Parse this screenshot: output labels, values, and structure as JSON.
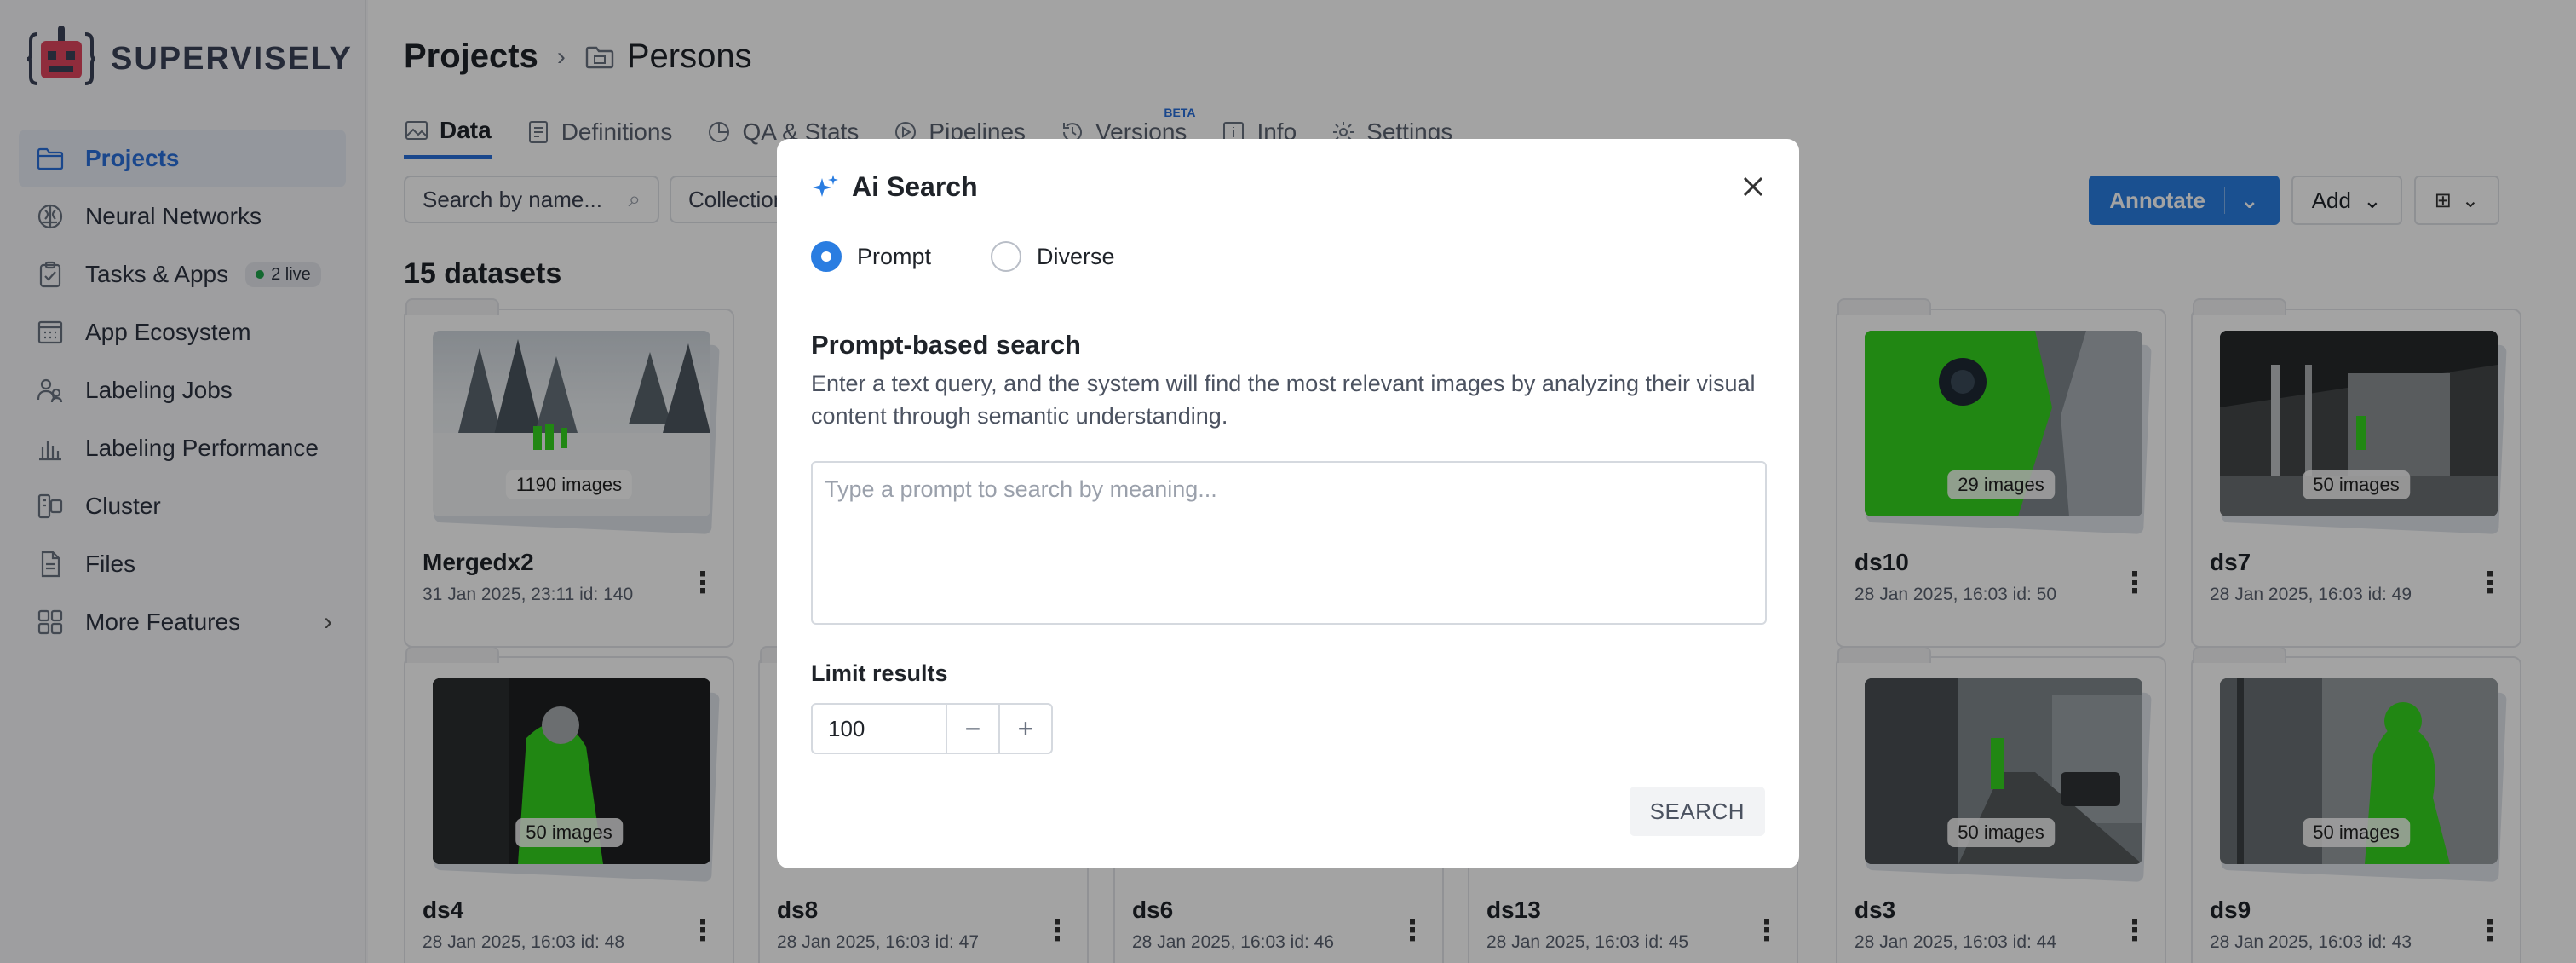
{
  "app": {
    "brand": "SUPERVISELY"
  },
  "sidebar": {
    "items": [
      {
        "label": "Projects",
        "icon": "folder-icon",
        "active": true
      },
      {
        "label": "Neural Networks",
        "icon": "brain-icon"
      },
      {
        "label": "Tasks & Apps",
        "icon": "clipboard-icon",
        "badge": "2 live"
      },
      {
        "label": "App Ecosystem",
        "icon": "grid-window-icon"
      },
      {
        "label": "Labeling Jobs",
        "icon": "people-icon"
      },
      {
        "label": "Labeling Performance",
        "icon": "bar-chart-icon"
      },
      {
        "label": "Cluster",
        "icon": "cluster-icon"
      },
      {
        "label": "Files",
        "icon": "file-icon"
      },
      {
        "label": "More Features",
        "icon": "apps-icon"
      }
    ]
  },
  "header": {
    "breadcrumb_root": "Projects",
    "breadcrumb_current": "Persons"
  },
  "tabs": [
    {
      "label": "Data",
      "active": true
    },
    {
      "label": "Definitions"
    },
    {
      "label": "QA & Stats"
    },
    {
      "label": "Pipelines"
    },
    {
      "label": "Versions",
      "badge": "BETA"
    },
    {
      "label": "Info"
    },
    {
      "label": "Settings"
    }
  ],
  "toolbar": {
    "search_placeholder": "Search by name...",
    "collection_label": "Collection",
    "annotate_label": "Annotate",
    "add_label": "Add"
  },
  "datasets_count_label": "15 datasets",
  "datasets": [
    {
      "name": "Mergedx2",
      "meta": "31 Jan 2025, 23:11  id: 140",
      "images": "1190 images",
      "theme": "snow"
    },
    {
      "name": "ds10",
      "meta": "28 Jan 2025, 16:03  id: 50",
      "images": "29 images",
      "theme": "green"
    },
    {
      "name": "ds7",
      "meta": "28 Jan 2025, 16:03  id: 49",
      "images": "50 images",
      "theme": "gray"
    },
    {
      "name": "ds4",
      "meta": "28 Jan 2025, 16:03  id: 48",
      "images": "50 images",
      "theme": "dark"
    },
    {
      "name": "ds8",
      "meta": "28 Jan 2025, 16:03  id: 47",
      "images": "",
      "theme": "green"
    },
    {
      "name": "ds6",
      "meta": "28 Jan 2025, 16:03  id: 46",
      "images": "",
      "theme": "dark"
    },
    {
      "name": "ds13",
      "meta": "28 Jan 2025, 16:03  id: 45",
      "images": "",
      "theme": "mixed"
    },
    {
      "name": "ds3",
      "meta": "28 Jan 2025, 16:03  id: 44",
      "images": "50 images",
      "theme": "street"
    },
    {
      "name": "ds9",
      "meta": "28 Jan 2025, 16:03  id: 43",
      "images": "50 images",
      "theme": "gray"
    }
  ],
  "modal": {
    "title": "Ai Search",
    "radio_prompt": "Prompt",
    "radio_diverse": "Diverse",
    "section_title": "Prompt-based search",
    "section_desc": "Enter a text query, and the system will find the most relevant images by analyzing their visual content through semantic understanding.",
    "prompt_placeholder": "Type a prompt to search by meaning...",
    "prompt_value": "",
    "limit_label": "Limit results",
    "limit_value": "100",
    "search_label": "SEARCH"
  },
  "colors": {
    "accent": "#2a7de1",
    "active_nav_bg": "#e8edf6",
    "annotation_green": "#35d31e"
  }
}
